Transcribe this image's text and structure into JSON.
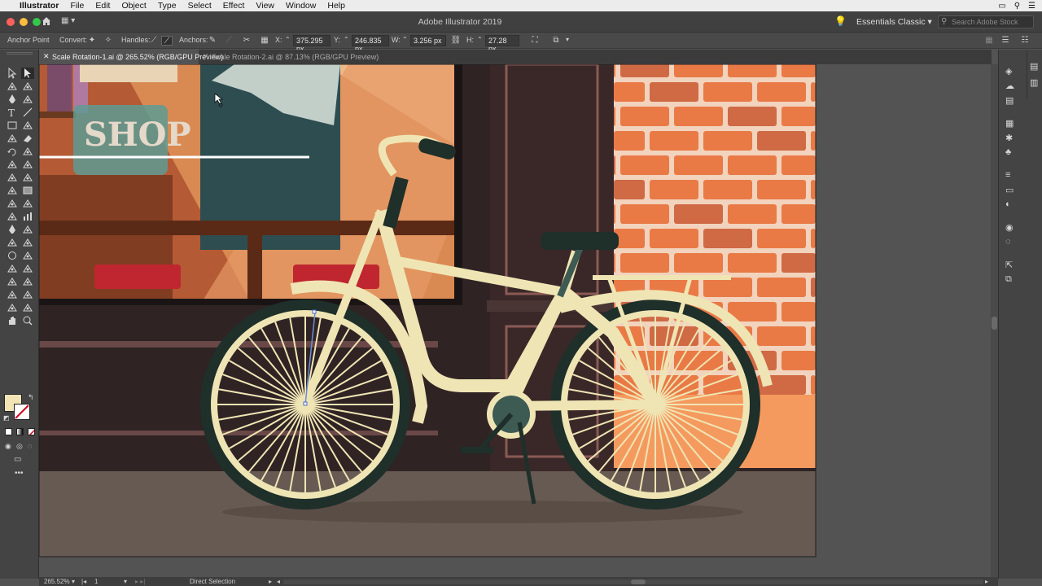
{
  "menubar": {
    "app_name": "Illustrator",
    "items": [
      "File",
      "Edit",
      "Object",
      "Type",
      "Select",
      "Effect",
      "View",
      "Window",
      "Help"
    ]
  },
  "appbar": {
    "title": "Adobe Illustrator 2019",
    "workspace": "Essentials Classic",
    "search_placeholder": "Search Adobe Stock"
  },
  "controlbar": {
    "tool_label": "Anchor Point",
    "convert_label": "Convert:",
    "handles_label": "Handles:",
    "anchors_label": "Anchors:",
    "x_label": "X:",
    "x_value": "375.295 px",
    "y_label": "Y:",
    "y_value": "246.835 px",
    "w_label": "W:",
    "w_value": "3.256 px",
    "h_label": "H:",
    "h_value": "27.28 px"
  },
  "tabs": [
    {
      "label": "Scale Rotation-1.ai @ 265.52% (RGB/GPU Preview)",
      "active": true
    },
    {
      "label": "Scale Rotation-2.ai @ 87.13% (RGB/GPU Preview)",
      "active": false
    }
  ],
  "artwork": {
    "shop_sign": "SHOP"
  },
  "statusbar": {
    "zoom": "265.52%",
    "artboard": "1",
    "current_tool": "Direct Selection"
  },
  "colors": {
    "fill_swatch": "#f3e4b6",
    "bike": "#efe5b4",
    "tire": "#1f2f2a",
    "brick": "#e97a46",
    "wall_dark": "#2f2324",
    "ground": "#675a52"
  }
}
